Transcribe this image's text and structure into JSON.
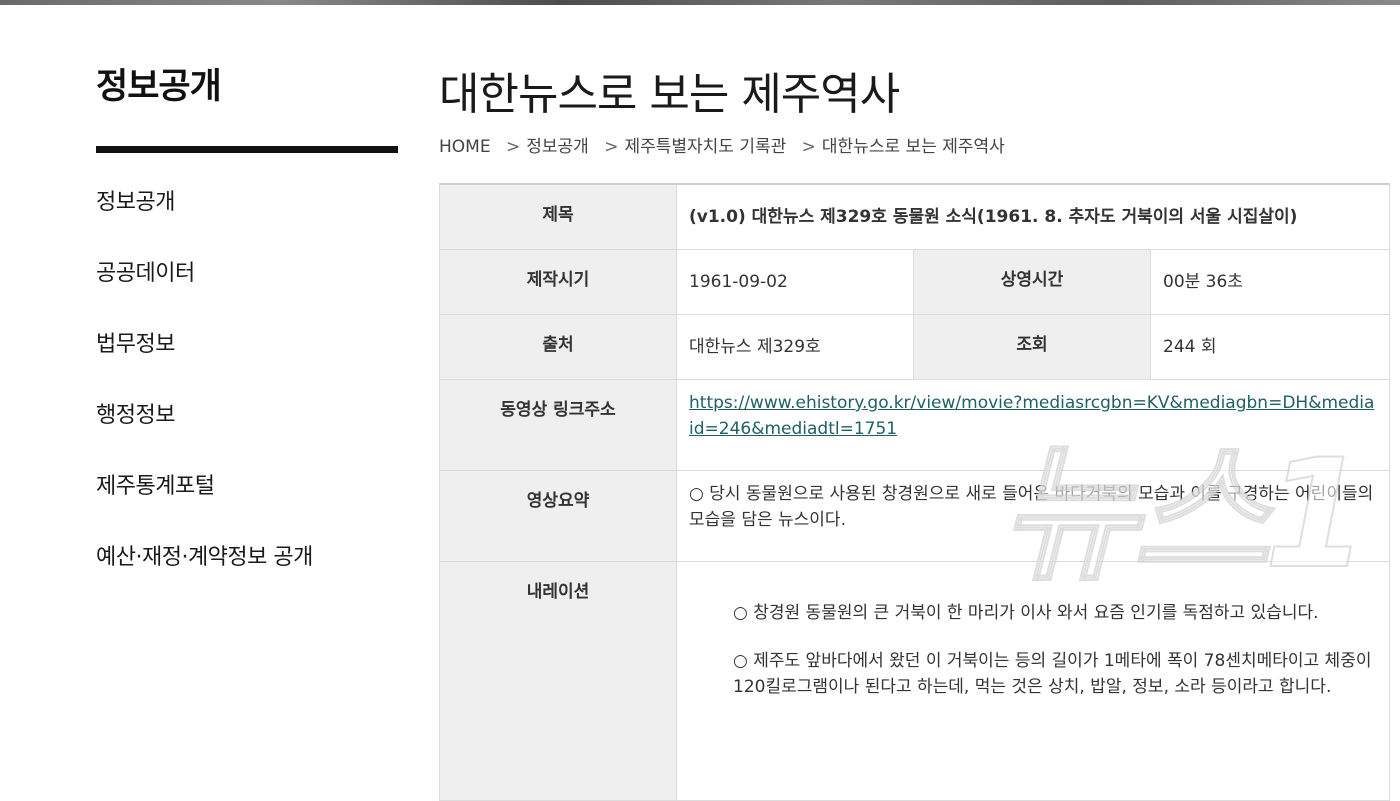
{
  "sidebar": {
    "title": "정보공개",
    "items": [
      {
        "label": "정보공개"
      },
      {
        "label": "공공데이터"
      },
      {
        "label": "법무정보"
      },
      {
        "label": "행정정보"
      },
      {
        "label": "제주통계포털"
      },
      {
        "label": "예산·재정·계약정보 공개"
      }
    ]
  },
  "main": {
    "title": "대한뉴스로 보는 제주역사",
    "breadcrumb": [
      "HOME",
      "정보공개",
      "제주특별자치도 기록관",
      "대한뉴스로 보는 제주역사"
    ],
    "breadcrumb_sep": ">",
    "table": {
      "title_label": "제목",
      "title_value": "(v1.0) 대한뉴스 제329호 동물원 소식(1961. 8. 추자도 거북이의 서울 시집살이)",
      "date_label": "제작시기",
      "date_value": "1961-09-02",
      "runtime_label": "상영시간",
      "runtime_value": "00분 36초",
      "source_label": "출처",
      "source_value": "대한뉴스 제329호",
      "views_label": "조회",
      "views_value": "244 회",
      "link_label": "동영상 링크주소",
      "link_value": "https://www.ehistory.go.kr/view/movie?mediasrcgbn=KV&mediagbn=DH&mediaid=246&mediadtl=1751",
      "summary_label": "영상요약",
      "summary_value": "○ 당시 동물원으로 사용된 창경원으로 새로 들어온 바다거북의 모습과 이를 구경하는 어린이들의 모습을 담은 뉴스이다.",
      "narration_label": "내레이션",
      "narration": [
        "○ 창경원 동물원의 큰 거북이 한 마리가 이사 와서 요즘 인기를 독점하고 있습니다.",
        "○ 제주도 앞바다에서 왔던 이 거북이는 등의 길이가 1메타에 폭이 78센치메타이고 체중이 120킬로그램이나 된다고 하는데, 먹는 것은 상치, 밥알, 정보, 소라 등이라고 합니다."
      ]
    }
  },
  "watermark": "뉴스1"
}
